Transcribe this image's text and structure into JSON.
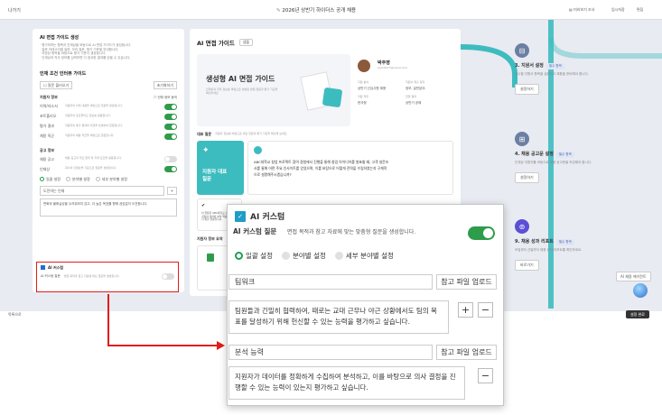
{
  "topbar": {
    "back": "나가기",
    "title": "2026년 상반기 하이더스 공개 채용",
    "preview": "미리보기 조사",
    "temp_save": "임시저장",
    "next": "편집"
  },
  "bottombar": {
    "left": "목록으로",
    "right": "설정 완료"
  },
  "left_panel": {
    "guide_title": "AI 면접 가이드 생성",
    "guide_lines": [
      "· 평가하려는 항목과 인재상을 바탕으로 AI 면접 가이드가 생성됩니다.",
      "· 질문 카테고리별 질문, 꼬리 질문, 평가 기준을 안내합니다.",
      "· 저장된 항목을 바탕으로 평가 기준이 생성됩니다.",
      "· 인재상과 직무 정보를 입력하면 더 정교한 결과를 얻을 수 있습니다."
    ],
    "condition_title": "인재 조건 인터뷰 가이드",
    "load_btn": "☐ 질문 불러오기",
    "reset_btn": "초기화하기",
    "support_title": "지원자 정보",
    "support_toggle": "전체 정보 동의",
    "rows": [
      {
        "label": "이력/자소서",
        "desc": "지원자의 이력 내용을 바탕으로 질문을 생성합니다."
      },
      {
        "label": "포트폴리오",
        "desc": "지원자의 포트폴리오 정보를 활용합니다."
      },
      {
        "label": "평가 결과",
        "desc": "지원자의 평가 결과와 의견을 반영하여 질문합니다."
      },
      {
        "label": "채용 직군",
        "desc": "지원자의 채용 직군을 바탕으로 질문합니다."
      }
    ],
    "job_title": "공고 정보",
    "job_rows": [
      {
        "label": "채용 공고",
        "desc": "채용 공고의 주요 업무 및 자격 요건을 활용합니다."
      },
      {
        "label": "인재상",
        "desc": "회사의 인재상을 기준으로 질문을 생성합니다."
      }
    ],
    "radios": [
      "일괄 설정",
      "분야별 설정",
      "세부 분야별 설정"
    ],
    "input_value": "도전하는 인재",
    "input_desc": "변화와 불확실성을 두려워하지 않고, 더 높은 목표를 향해 끊임없이 도전합니다.",
    "ai_custom": "AI 커스텀",
    "ai_custom_row": "AI 커스텀 질문",
    "ai_custom_desc": "면접 목적과 참고 자료에 맞는 질문을 생성합니다."
  },
  "mid_panel": {
    "title": "AI 면접 가이드",
    "badge": "샘플",
    "banner_title": "생성형 AI 면접 가이드",
    "banner_sub": "인재상과 직무 정보를 바탕으로 생성된 면접 질문과 평가 기준을 확인하세요.",
    "person_name": "박주영",
    "person_mail": "park0127@naver.com",
    "info": [
      [
        "지원 분야",
        "지원서 제출 일자"
      ],
      [
        "상반기 신입사원 채용",
        "정보, 일반분야"
      ],
      [
        "지원 직무",
        "전형 결과"
      ],
      [
        "한국형",
        "상반기 공채"
      ]
    ],
    "section": "대표 질문",
    "section_desc": "지원자 정보를 바탕으로 대표 질문과 평가 기준을 확인해 보세요.",
    "card_label": "지원자 대표 질문",
    "card_text": "ABC대학교 창업 프로젝트 참여 경험에서 진행을 통해 창업 아이디어를 발표할 때, 고객 설문조사를 통해 어떤 주요 인사이트를 얻었으며, 이를 바탕으로 어떻게 전략을 수립하였는지 구체적으로 설명해주시겠습니까?",
    "sub_text": "이 질문은 ABC대학교 프로젝트 경험과 데이터 분석 역량을 확인하기 위한 질문입니다.",
    "sub_text2": "채용 평가 지표 반영",
    "support_section": "지원자 정보 요약",
    "support_btn": "이력서 보기"
  },
  "steps": [
    {
      "num": "⊟",
      "title": "3. 지원서 설정",
      "badge": "필수 항목",
      "desc": "접수할 지원서 항목을 설정하고 채용을 준비해야 합니다.",
      "btn": "설정하기"
    },
    {
      "num": "⊞",
      "title": "4. 채용 공고문 설정",
      "badge": "필수 항목",
      "desc": "인재상 지원자를 바탕으로 채용 공고문을 작성해야 합니다.",
      "btn": "설정하기"
    },
    {
      "num": "⊚",
      "title": "9. 채용 성과 리포트",
      "badge": "필수 항목",
      "desc": "모집부터 선발까지 채용 성과 리포트를 확인하세요.",
      "btn": "바로가기"
    }
  ],
  "side_btn": "AI 채용 에이전트",
  "popup": {
    "title": "AI 커스텀",
    "row_label": "AI 커스텀 질문",
    "row_desc": "면접 목적과 참고 자료에 맞는 맞춤형 질문을 생성합니다.",
    "radios": [
      "일괄 설정",
      "분야별 설정",
      "세부 분야별 설정"
    ],
    "items": [
      {
        "field": "팀워크",
        "upload": "참고 파일 업로드",
        "text": "팀원들과 긴밀히 협력하여, 때로는 교대 근무나 야근 상황에서도 팀의 목표를 달성하기 위해 헌신할 수 있는 능력을 평가하고 싶습니다."
      },
      {
        "field": "분석 능력",
        "upload": "참고 파일 업로드",
        "text": "지원자가 데이터를 정확하게 수집하여 분석하고, 이를 바탕으로 의사 결정을 진행할 수 있는 능력이 있는지 평가하고 싶습니다."
      }
    ],
    "plus": "+",
    "minus": "−"
  },
  "colors": {
    "accent_green": "#1f9d55",
    "highlight_red": "#e21b1b",
    "teal": "#3dbcc0"
  }
}
